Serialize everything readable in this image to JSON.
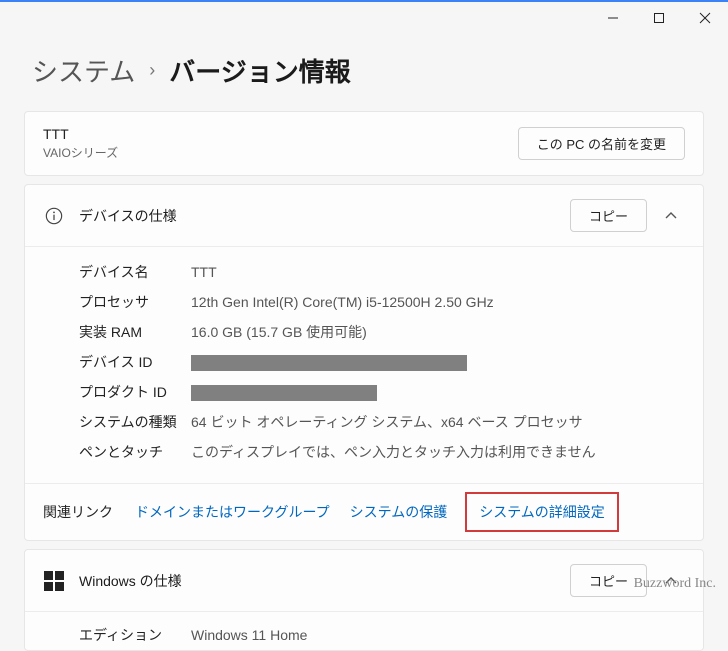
{
  "window": {
    "breadcrumb_root": "システム",
    "breadcrumb_current": "バージョン情報"
  },
  "pc_card": {
    "name": "TTT",
    "series": "VAIOシリーズ",
    "rename_button": "この PC の名前を変更"
  },
  "device_spec": {
    "title": "デバイスの仕様",
    "copy_button": "コピー",
    "rows": {
      "device_name_label": "デバイス名",
      "device_name_value": "TTT",
      "processor_label": "プロセッサ",
      "processor_value": "12th Gen Intel(R) Core(TM) i5-12500H   2.50 GHz",
      "ram_label": "実装 RAM",
      "ram_value": "16.0 GB (15.7 GB 使用可能)",
      "device_id_label": "デバイス ID",
      "product_id_label": "プロダクト ID",
      "system_type_label": "システムの種類",
      "system_type_value": "64 ビット オペレーティング システム、x64 ベース プロセッサ",
      "pen_touch_label": "ペンとタッチ",
      "pen_touch_value": "このディスプレイでは、ペン入力とタッチ入力は利用できません"
    },
    "related_links": {
      "label": "関連リンク",
      "domain_workgroup": "ドメインまたはワークグループ",
      "system_protection": "システムの保護",
      "system_advanced": "システムの詳細設定"
    }
  },
  "windows_spec": {
    "title": "Windows の仕様",
    "copy_button": "コピー",
    "rows": {
      "edition_label": "エディション",
      "edition_value": "Windows 11 Home"
    }
  },
  "watermark": "Buzzword Inc."
}
